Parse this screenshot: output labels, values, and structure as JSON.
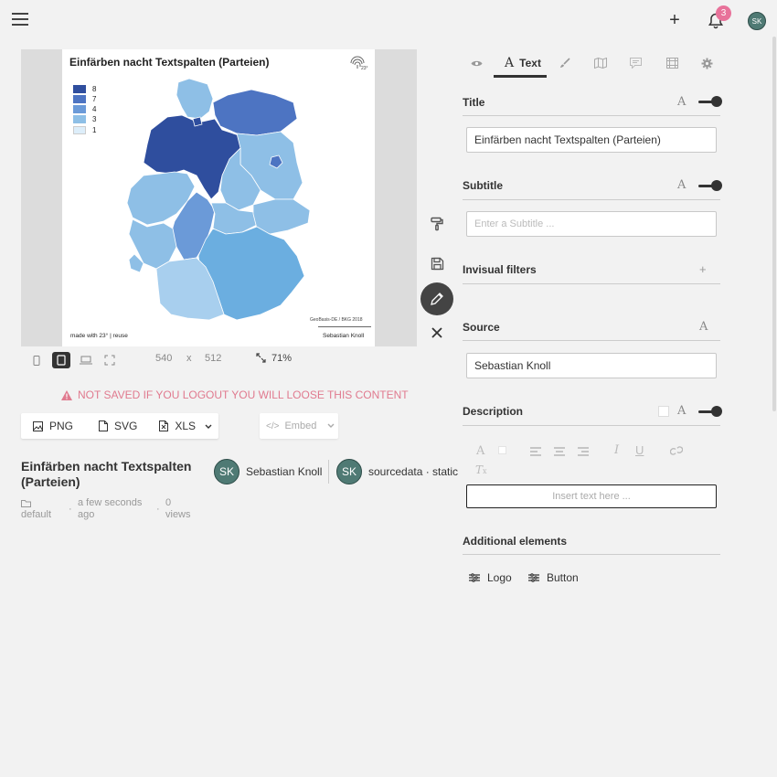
{
  "topbar": {
    "add_label": "+",
    "notification_count": "3",
    "user_initials": "SK"
  },
  "chart": {
    "title": "Einfärben nacht Textspalten (Parteien)",
    "legend": [
      {
        "label": "8",
        "color": "#2f4e9e"
      },
      {
        "label": "7",
        "color": "#4d74c2"
      },
      {
        "label": "4",
        "color": "#6b9ad8"
      },
      {
        "label": "3",
        "color": "#8ebfe6"
      },
      {
        "label": "1",
        "color": "#ddeefa"
      }
    ],
    "made_with": "made with 23° | reuse",
    "geobasis": "GeoBasis-DE / BKG 2018",
    "source": "Sebastian Knoll"
  },
  "size_toolbar": {
    "width": "540",
    "x": "x",
    "height": "512",
    "zoom": "71%"
  },
  "warning": "NOT SAVED IF YOU LOGOUT YOU WILL LOOSE THIS CONTENT",
  "export": {
    "png": "PNG",
    "svg": "SVG",
    "xls": "XLS",
    "embed": "Embed"
  },
  "info": {
    "name": "Einfärben nacht Textspalten (Parteien)",
    "folder": "default",
    "time": "a few seconds ago",
    "views_count": "0",
    "views_label": "views",
    "author_initials": "SK",
    "author_name": "Sebastian Knoll",
    "source_initials": "SK",
    "source_name": "sourcedata · static"
  },
  "panel": {
    "tabs": {
      "text_label": "Text"
    },
    "title": {
      "label": "Title",
      "value": "Einfärben nacht Textspalten (Parteien)"
    },
    "subtitle": {
      "label": "Subtitle",
      "placeholder": "Enter a Subtitle ..."
    },
    "filters": {
      "label": "Invisual filters",
      "add": "+"
    },
    "source": {
      "label": "Source",
      "value": "Sebastian Knoll"
    },
    "description": {
      "label": "Description",
      "placeholder": "Insert text here ..."
    },
    "additional": {
      "label": "Additional elements",
      "logo": "Logo",
      "button": "Button"
    }
  }
}
